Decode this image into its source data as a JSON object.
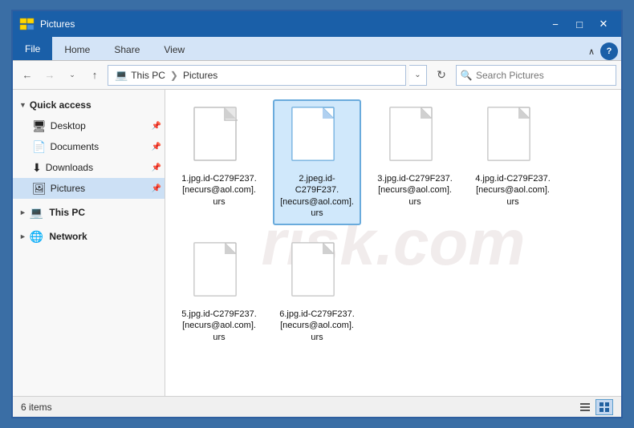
{
  "window": {
    "title": "Pictures",
    "title_icon": "folder-icon"
  },
  "titlebar": {
    "minimize_label": "−",
    "restore_label": "□",
    "close_label": "✕"
  },
  "ribbon": {
    "tabs": [
      "File",
      "Home",
      "Share",
      "View"
    ],
    "active_tab": "File",
    "chevron_icon": "chevron-icon",
    "help_icon": "help-icon",
    "help_label": "?"
  },
  "addressbar": {
    "back_btn": "←",
    "forward_btn": "→",
    "dropdown_btn": "∨",
    "up_btn": "↑",
    "path_parts": [
      "This PC",
      "Pictures"
    ],
    "path_separator": ">",
    "refresh_icon": "↻",
    "search_placeholder": "Search Pictures",
    "search_icon": "🔍"
  },
  "sidebar": {
    "sections": [
      {
        "id": "quick-access",
        "label": "Quick access",
        "expanded": true,
        "items": [
          {
            "id": "desktop",
            "label": "Desktop",
            "icon": "🖥",
            "pinned": true
          },
          {
            "id": "documents",
            "label": "Documents",
            "icon": "📄",
            "pinned": true
          },
          {
            "id": "downloads",
            "label": "Downloads",
            "icon": "⬇",
            "pinned": true
          },
          {
            "id": "pictures",
            "label": "Pictures",
            "icon": "🖼",
            "pinned": true,
            "selected": true
          }
        ]
      },
      {
        "id": "this-pc",
        "label": "This PC",
        "expanded": false,
        "items": []
      },
      {
        "id": "network",
        "label": "Network",
        "expanded": false,
        "items": []
      }
    ]
  },
  "files": [
    {
      "id": "file1",
      "name": "1.jpg.id-C279F237.[necurs@aol.com].urs",
      "selected": false
    },
    {
      "id": "file2",
      "name": "2.jpeg.id-C279F237.[necurs@aol.com].urs",
      "selected": true
    },
    {
      "id": "file3",
      "name": "3.jpg.id-C279F237.[necurs@aol.com].urs",
      "selected": false
    },
    {
      "id": "file4",
      "name": "4.jpg.id-C279F237.[necurs@aol.com].urs",
      "selected": false
    },
    {
      "id": "file5",
      "name": "5.jpg.id-C279F237.[necurs@aol.com].urs",
      "selected": false
    },
    {
      "id": "file6",
      "name": "6.jpg.id-C279F237.[necurs@aol.com].urs",
      "selected": false
    }
  ],
  "statusbar": {
    "item_count": "6 items",
    "view_icons": [
      "list-view-icon",
      "large-icon-view-icon"
    ]
  },
  "watermark": {
    "text": "risk.com"
  }
}
